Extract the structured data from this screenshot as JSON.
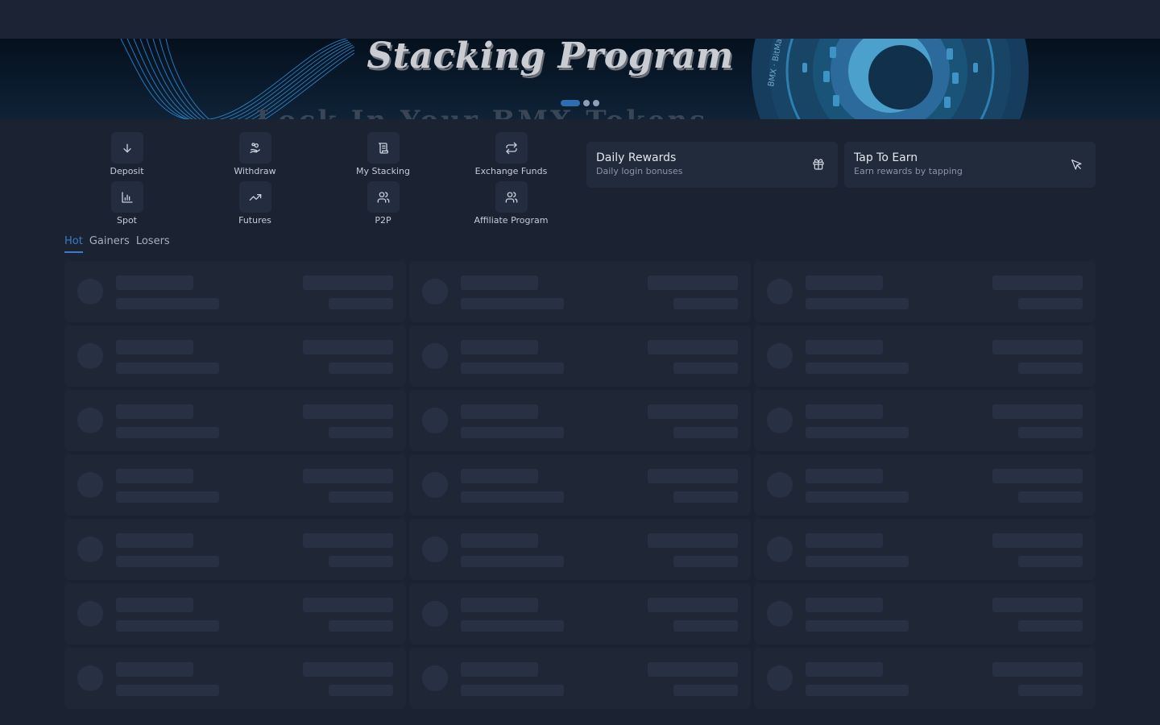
{
  "banner": {
    "title": "Stacking Program",
    "subtitle": "Lock In Your BMX Tokens",
    "coin_text": "BitMaxit · BMX",
    "slides": 3,
    "active_slide": 0
  },
  "actions": [
    {
      "label": "Deposit",
      "icon": "arrow-down-icon"
    },
    {
      "label": "Withdraw",
      "icon": "hand-coins-icon"
    },
    {
      "label": "My Stacking",
      "icon": "scroll-icon"
    },
    {
      "label": "Exchange Funds",
      "icon": "repeat-icon"
    },
    {
      "label": "Spot",
      "icon": "bar-chart-icon"
    },
    {
      "label": "Futures",
      "icon": "trending-up-icon"
    },
    {
      "label": "P2P",
      "icon": "users-icon"
    },
    {
      "label": "Affiliate Program",
      "icon": "users-icon"
    }
  ],
  "rewards": [
    {
      "title": "Daily Rewards",
      "subtitle": "Daily login bonuses",
      "icon": "gift-icon"
    },
    {
      "title": "Tap To Earn",
      "subtitle": "Earn rewards by tapping",
      "icon": "cursor-click-icon"
    }
  ],
  "market_tabs": [
    "Hot",
    "Gainers",
    "Losers"
  ],
  "active_market_tab": "Hot",
  "market_list": {
    "loading": true,
    "placeholder_rows": 7,
    "placeholder_columns": 3
  },
  "colors": {
    "background": "#1b2232",
    "card": "#222b3c",
    "accent": "#3c7cc4",
    "skeleton": "#283143"
  }
}
